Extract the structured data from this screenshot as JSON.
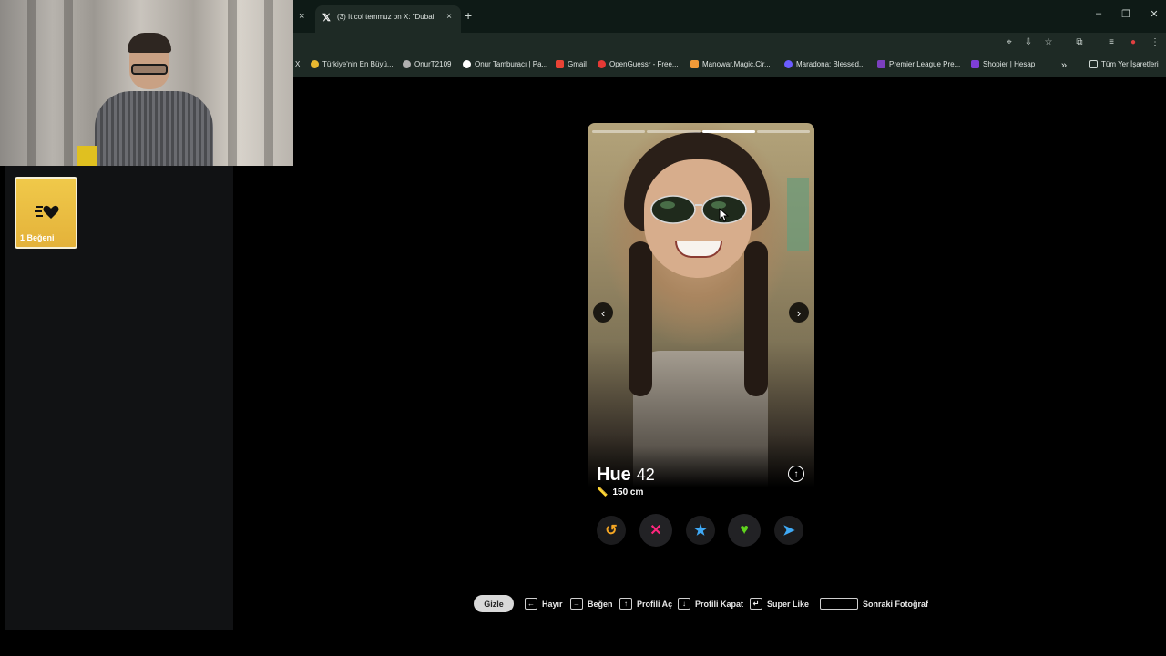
{
  "browser": {
    "tab_prev_close": "×",
    "tab_title": "(3) It col temmuz on X: \"Dubai",
    "tab_close": "×",
    "new_tab": "+",
    "window_controls": [
      "–",
      "❐",
      "✕"
    ],
    "toolbar_icons": [
      "location-icon",
      "install-icon",
      "star-icon",
      "extensions-icon",
      "media-icon",
      "profile-icon",
      "menu-icon"
    ]
  },
  "bookmarks": [
    {
      "label": "X",
      "color": "#cfd8d4"
    },
    {
      "label": "Türkiye'nin En Büyü...",
      "color": "#e8b830"
    },
    {
      "label": "OnurT2109",
      "color": "#b0b0b0"
    },
    {
      "label": "Onur Tamburacı | Pa...",
      "color": "#ffffff"
    },
    {
      "label": "Gmail",
      "color": "#ea4335"
    },
    {
      "label": "OpenGuessr - Free...",
      "color": "#e53935"
    },
    {
      "label": "Manowar.Magic.Cir...",
      "color": "#f29b38"
    },
    {
      "label": "Maradona: Blessed...",
      "color": "#6b5cff"
    },
    {
      "label": "Premier League Pre...",
      "color": "#7b3fbf"
    },
    {
      "label": "Shopier | Hesap",
      "color": "#7e3fd6"
    }
  ],
  "bookmarks_more": "»",
  "bookmarks_all": "Tüm Yer İşaretleri",
  "sidebar": {
    "likes_label": "1 Beğeni",
    "likes_color": "#f0c94a"
  },
  "profile": {
    "name": "Hue",
    "age": "42",
    "height": "150 cm",
    "photo_count": 4,
    "active_photo": 2,
    "info_icon": "up-arrow-icon"
  },
  "actions": [
    {
      "name": "rewind",
      "glyph": "↺",
      "color": "#f5a623"
    },
    {
      "name": "nope",
      "glyph": "✕",
      "color": "#fd267d"
    },
    {
      "name": "super-like",
      "glyph": "★",
      "color": "#3fa9f5"
    },
    {
      "name": "like",
      "glyph": "♥",
      "color": "#5fd31d"
    },
    {
      "name": "boost",
      "glyph": "➤",
      "color": "#3fa9f5"
    }
  ],
  "shortcuts": {
    "hide": "Gizle",
    "items": [
      {
        "key": "←",
        "label": "Hayır"
      },
      {
        "key": "→",
        "label": "Beğen"
      },
      {
        "key": "↑",
        "label": "Profili Aç"
      },
      {
        "key": "↓",
        "label": "Profili Kapat"
      },
      {
        "key": "↵",
        "label": "Super Like"
      },
      {
        "key": "",
        "label": "Sonraki Fotoğraf"
      }
    ]
  }
}
